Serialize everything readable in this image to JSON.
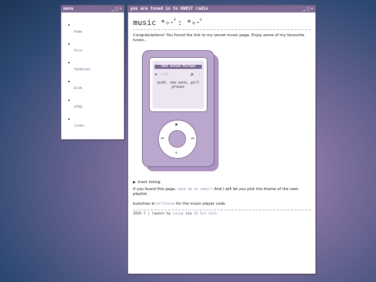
{
  "menu_window": {
    "title": "menu",
    "buttons": {
      "minimize": "_",
      "maximize": "□",
      "close": "✕"
    },
    "items": [
      {
        "label": "home"
      },
      {
        "label": "fics"
      },
      {
        "label": "fanmixes"
      },
      {
        "label": "blob"
      },
      {
        "label": "iFAQ"
      },
      {
        "label": "links"
      }
    ]
  },
  "main_window": {
    "title": "you are tuned in to KWEST radio",
    "buttons": {
      "minimize": "_",
      "maximize": "□",
      "close": "✕"
    },
    "heading": "music *✧･ﾟ: *✧･ﾟ",
    "intro": "Congratulations! You found the link to my secret music page. Enjoy some of my favourite tunes...",
    "player": {
      "title": "2025 Autumn Mixtape",
      "play_icon": "▶",
      "time": "0:00",
      "volume_icon": "🔊",
      "more_icon": "⋮",
      "genres": "punk, new wave, girl groups",
      "wheel": {
        "play": "▶",
        "prev": "⏮",
        "next": "⏭",
        "pause": "⏸"
      }
    },
    "track_listing": {
      "marker": "▶",
      "label": "track listing"
    },
    "theme_text": {
      "before": "If you found this page, ",
      "link": "send me an email!",
      "after": " And I will let you pick the theme of the next playlist."
    },
    "credit_text": {
      "before": "buiochas le ",
      "link": "hillhouse",
      "after": " for the music player code."
    },
    "footer": {
      "year": "2025-7",
      "sep": " | layout by ",
      "author": "Lesya",
      "via": " via ",
      "site": "32 bit Cafe"
    }
  },
  "colors": {
    "titlebar": "#7f6a93",
    "accent": "#9a84ad",
    "ipod_body": "#bba6cd"
  }
}
